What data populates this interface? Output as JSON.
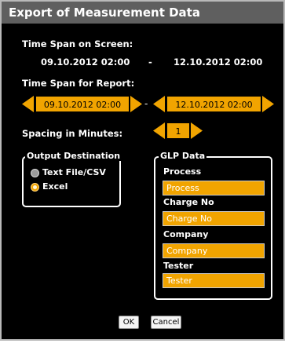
{
  "window": {
    "title": "Export of Measurement Data"
  },
  "screen_span": {
    "label": "Time Span on Screen:",
    "from": "09.10.2012 02:00",
    "separator": "-",
    "to": "12.10.2012 02:00"
  },
  "report_span": {
    "label": "Time Span for Report:",
    "from": "09.10.2012 02:00",
    "separator": "-",
    "to": "12.10.2012 02:00"
  },
  "spacing": {
    "label": "Spacing in Minutes:",
    "value": "1"
  },
  "output": {
    "title": "Output Destination",
    "options": [
      {
        "label": "Text File/CSV",
        "selected": false
      },
      {
        "label": "Excel",
        "selected": true
      }
    ]
  },
  "glp": {
    "title": "GLP Data",
    "fields": [
      {
        "label": "Process",
        "value": "Process"
      },
      {
        "label": "Charge No",
        "value": "Charge No"
      },
      {
        "label": "Company",
        "value": "Company"
      },
      {
        "label": "Tester",
        "value": "Tester"
      }
    ]
  },
  "buttons": {
    "ok": "OK",
    "cancel": "Cancel"
  },
  "colors": {
    "accent": "#f1a400",
    "background": "#000000",
    "titlebar": "#5f5f5f"
  }
}
